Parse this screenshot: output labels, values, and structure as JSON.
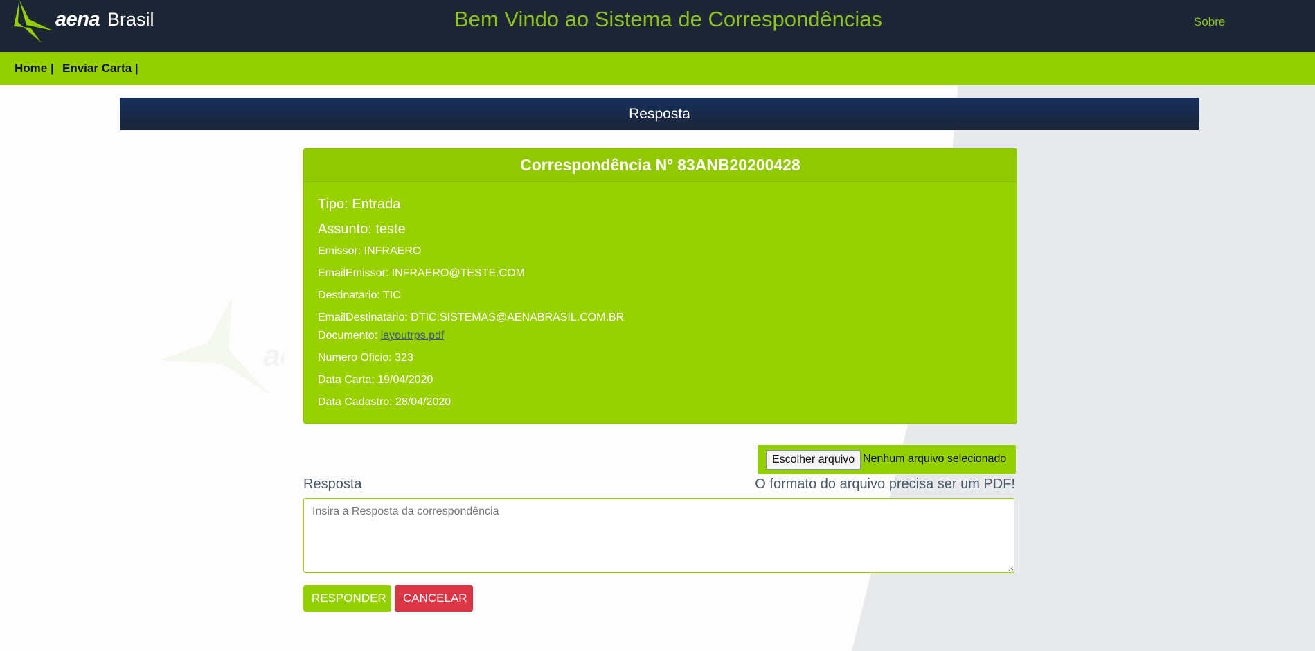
{
  "header": {
    "logo_aena": "aena",
    "logo_brasil": "Brasil",
    "welcome_title": "Bem Vindo ao Sistema de Correspondências",
    "sobre_link": "Sobre"
  },
  "nav": {
    "items": [
      {
        "label": "Home |"
      },
      {
        "label": "Enviar Carta |"
      }
    ]
  },
  "section": {
    "title": "Resposta"
  },
  "card": {
    "title": "Correspondência Nº 83ANB20200428",
    "tipo": "Tipo: Entrada",
    "assunto": "Assunto: teste",
    "emissor": "Emissor: INFRAERO",
    "email_emissor": "EmailEmissor: INFRAERO@TESTE.COM",
    "destinatario": "Destinatario: TIC",
    "email_destinatario": "EmailDestinatario: DTIC.SISTEMAS@AENABRASIL.COM.BR",
    "documento_label": "Documento: ",
    "documento_file": "layoutrps.pdf",
    "numero_oficio": "Numero Oficio: 323",
    "data_carta": "Data Carta: 19/04/2020",
    "data_cadastro": "Data Cadastro: 28/04/2020"
  },
  "form": {
    "file_button": "Escolher arquivo",
    "file_status": "Nenhum arquivo selecionado",
    "resposta_label": "Resposta",
    "format_hint": "O formato do arquivo precisa ser um PDF!",
    "textarea_placeholder": "Insira a Resposta da correspondência",
    "responder_button": "RESPONDER",
    "cancelar_button": "CANCELAR"
  },
  "colors": {
    "header_bg": "#1c2634",
    "accent_green": "#94cf00",
    "danger_red": "#dc3545"
  }
}
